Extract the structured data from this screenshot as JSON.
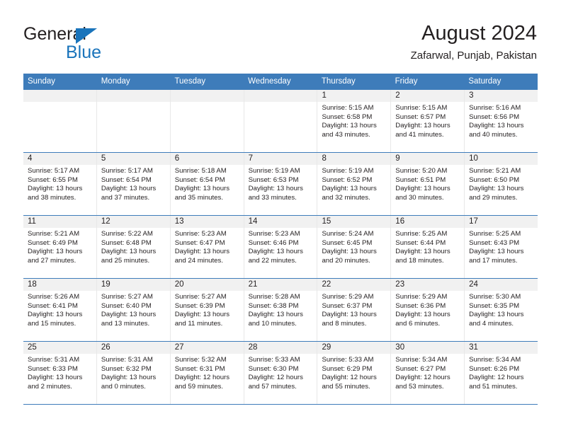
{
  "brand": {
    "line1": "General",
    "line2": "Blue",
    "accent": "#1a74bb",
    "triangle_icon": "triangle-logo-icon"
  },
  "header": {
    "title": "August 2024",
    "subtitle": "Zafarwal, Punjab, Pakistan"
  },
  "theme": {
    "header_blue": "#3e7cba",
    "daynum_band": "#f1f1f1",
    "text": "#231f20"
  },
  "weekdays": [
    "Sunday",
    "Monday",
    "Tuesday",
    "Wednesday",
    "Thursday",
    "Friday",
    "Saturday"
  ],
  "weeks": [
    [
      {
        "day": "",
        "sunrise": "",
        "sunset": "",
        "daylight": ""
      },
      {
        "day": "",
        "sunrise": "",
        "sunset": "",
        "daylight": ""
      },
      {
        "day": "",
        "sunrise": "",
        "sunset": "",
        "daylight": ""
      },
      {
        "day": "",
        "sunrise": "",
        "sunset": "",
        "daylight": ""
      },
      {
        "day": "1",
        "sunrise": "Sunrise: 5:15 AM",
        "sunset": "Sunset: 6:58 PM",
        "daylight": "Daylight: 13 hours and 43 minutes."
      },
      {
        "day": "2",
        "sunrise": "Sunrise: 5:15 AM",
        "sunset": "Sunset: 6:57 PM",
        "daylight": "Daylight: 13 hours and 41 minutes."
      },
      {
        "day": "3",
        "sunrise": "Sunrise: 5:16 AM",
        "sunset": "Sunset: 6:56 PM",
        "daylight": "Daylight: 13 hours and 40 minutes."
      }
    ],
    [
      {
        "day": "4",
        "sunrise": "Sunrise: 5:17 AM",
        "sunset": "Sunset: 6:55 PM",
        "daylight": "Daylight: 13 hours and 38 minutes."
      },
      {
        "day": "5",
        "sunrise": "Sunrise: 5:17 AM",
        "sunset": "Sunset: 6:54 PM",
        "daylight": "Daylight: 13 hours and 37 minutes."
      },
      {
        "day": "6",
        "sunrise": "Sunrise: 5:18 AM",
        "sunset": "Sunset: 6:54 PM",
        "daylight": "Daylight: 13 hours and 35 minutes."
      },
      {
        "day": "7",
        "sunrise": "Sunrise: 5:19 AM",
        "sunset": "Sunset: 6:53 PM",
        "daylight": "Daylight: 13 hours and 33 minutes."
      },
      {
        "day": "8",
        "sunrise": "Sunrise: 5:19 AM",
        "sunset": "Sunset: 6:52 PM",
        "daylight": "Daylight: 13 hours and 32 minutes."
      },
      {
        "day": "9",
        "sunrise": "Sunrise: 5:20 AM",
        "sunset": "Sunset: 6:51 PM",
        "daylight": "Daylight: 13 hours and 30 minutes."
      },
      {
        "day": "10",
        "sunrise": "Sunrise: 5:21 AM",
        "sunset": "Sunset: 6:50 PM",
        "daylight": "Daylight: 13 hours and 29 minutes."
      }
    ],
    [
      {
        "day": "11",
        "sunrise": "Sunrise: 5:21 AM",
        "sunset": "Sunset: 6:49 PM",
        "daylight": "Daylight: 13 hours and 27 minutes."
      },
      {
        "day": "12",
        "sunrise": "Sunrise: 5:22 AM",
        "sunset": "Sunset: 6:48 PM",
        "daylight": "Daylight: 13 hours and 25 minutes."
      },
      {
        "day": "13",
        "sunrise": "Sunrise: 5:23 AM",
        "sunset": "Sunset: 6:47 PM",
        "daylight": "Daylight: 13 hours and 24 minutes."
      },
      {
        "day": "14",
        "sunrise": "Sunrise: 5:23 AM",
        "sunset": "Sunset: 6:46 PM",
        "daylight": "Daylight: 13 hours and 22 minutes."
      },
      {
        "day": "15",
        "sunrise": "Sunrise: 5:24 AM",
        "sunset": "Sunset: 6:45 PM",
        "daylight": "Daylight: 13 hours and 20 minutes."
      },
      {
        "day": "16",
        "sunrise": "Sunrise: 5:25 AM",
        "sunset": "Sunset: 6:44 PM",
        "daylight": "Daylight: 13 hours and 18 minutes."
      },
      {
        "day": "17",
        "sunrise": "Sunrise: 5:25 AM",
        "sunset": "Sunset: 6:43 PM",
        "daylight": "Daylight: 13 hours and 17 minutes."
      }
    ],
    [
      {
        "day": "18",
        "sunrise": "Sunrise: 5:26 AM",
        "sunset": "Sunset: 6:41 PM",
        "daylight": "Daylight: 13 hours and 15 minutes."
      },
      {
        "day": "19",
        "sunrise": "Sunrise: 5:27 AM",
        "sunset": "Sunset: 6:40 PM",
        "daylight": "Daylight: 13 hours and 13 minutes."
      },
      {
        "day": "20",
        "sunrise": "Sunrise: 5:27 AM",
        "sunset": "Sunset: 6:39 PM",
        "daylight": "Daylight: 13 hours and 11 minutes."
      },
      {
        "day": "21",
        "sunrise": "Sunrise: 5:28 AM",
        "sunset": "Sunset: 6:38 PM",
        "daylight": "Daylight: 13 hours and 10 minutes."
      },
      {
        "day": "22",
        "sunrise": "Sunrise: 5:29 AM",
        "sunset": "Sunset: 6:37 PM",
        "daylight": "Daylight: 13 hours and 8 minutes."
      },
      {
        "day": "23",
        "sunrise": "Sunrise: 5:29 AM",
        "sunset": "Sunset: 6:36 PM",
        "daylight": "Daylight: 13 hours and 6 minutes."
      },
      {
        "day": "24",
        "sunrise": "Sunrise: 5:30 AM",
        "sunset": "Sunset: 6:35 PM",
        "daylight": "Daylight: 13 hours and 4 minutes."
      }
    ],
    [
      {
        "day": "25",
        "sunrise": "Sunrise: 5:31 AM",
        "sunset": "Sunset: 6:33 PM",
        "daylight": "Daylight: 13 hours and 2 minutes."
      },
      {
        "day": "26",
        "sunrise": "Sunrise: 5:31 AM",
        "sunset": "Sunset: 6:32 PM",
        "daylight": "Daylight: 13 hours and 0 minutes."
      },
      {
        "day": "27",
        "sunrise": "Sunrise: 5:32 AM",
        "sunset": "Sunset: 6:31 PM",
        "daylight": "Daylight: 12 hours and 59 minutes."
      },
      {
        "day": "28",
        "sunrise": "Sunrise: 5:33 AM",
        "sunset": "Sunset: 6:30 PM",
        "daylight": "Daylight: 12 hours and 57 minutes."
      },
      {
        "day": "29",
        "sunrise": "Sunrise: 5:33 AM",
        "sunset": "Sunset: 6:29 PM",
        "daylight": "Daylight: 12 hours and 55 minutes."
      },
      {
        "day": "30",
        "sunrise": "Sunrise: 5:34 AM",
        "sunset": "Sunset: 6:27 PM",
        "daylight": "Daylight: 12 hours and 53 minutes."
      },
      {
        "day": "31",
        "sunrise": "Sunrise: 5:34 AM",
        "sunset": "Sunset: 6:26 PM",
        "daylight": "Daylight: 12 hours and 51 minutes."
      }
    ]
  ]
}
